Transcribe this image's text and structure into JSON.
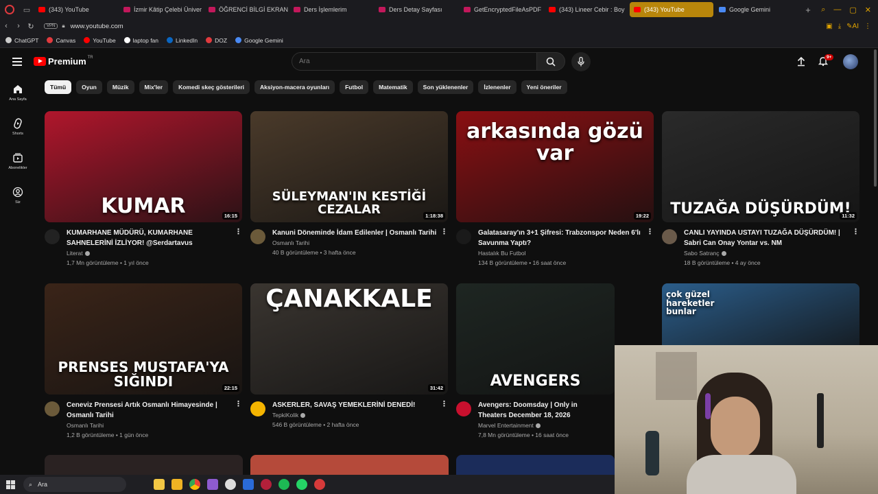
{
  "browser": {
    "tabs": [
      {
        "label": "(343) YouTube",
        "color": "#ff0000",
        "active": false
      },
      {
        "label": "İzmir Kâtip Çelebi Üniver",
        "color": "#c2185b",
        "active": false
      },
      {
        "label": "ÖĞRENCİ BİLGİ EKRANI*",
        "color": "#c2185b",
        "active": false
      },
      {
        "label": "Ders İşlemlerim",
        "color": "#c2185b",
        "active": false
      },
      {
        "label": "Ders Detay Sayfası",
        "color": "#c2185b",
        "active": false
      },
      {
        "label": "GetEncryptedFileAsPDF",
        "color": "#c2185b",
        "active": false
      },
      {
        "label": "(343) Lineer Cebir : Boy",
        "color": "#ff0000",
        "active": false
      },
      {
        "label": "(343) YouTube",
        "color": "#ff0000",
        "active": true
      },
      {
        "label": "Google Gemini",
        "color": "#4a8af4",
        "active": false
      }
    ],
    "vpn_label": "VPN",
    "url": "www.youtube.com",
    "ai_label": "AI",
    "bookmarks": [
      {
        "label": "ChatGPT",
        "color": "#cccccc"
      },
      {
        "label": "Canvas",
        "color": "#e03a3e"
      },
      {
        "label": "YouTube",
        "color": "#ff0000"
      },
      {
        "label": "laptop fan",
        "color": "#ffffff"
      },
      {
        "label": "LinkedIn",
        "color": "#0a66c2"
      },
      {
        "label": "DOZ",
        "color": "#e03a3e"
      },
      {
        "label": "Google Gemini",
        "color": "#4a8af4"
      }
    ]
  },
  "youtube": {
    "logo_text": "Premium",
    "logo_region": "TR",
    "search_placeholder": "Ara",
    "notification_count": "9+",
    "sidebar": [
      {
        "label": "Ana Sayfa",
        "icon": "home-icon"
      },
      {
        "label": "Shorts",
        "icon": "shorts-icon"
      },
      {
        "label": "Abonelikler",
        "icon": "subscriptions-icon"
      },
      {
        "label": "Siz",
        "icon": "you-icon"
      }
    ],
    "chips": [
      "Tümü",
      "Oyun",
      "Müzik",
      "Mix'ler",
      "Komedi skeç gösterileri",
      "Aksiyon-macera oyunları",
      "Futbol",
      "Matematik",
      "Son yüklenenler",
      "İzlenenler",
      "Yeni öneriler"
    ],
    "videos": [
      {
        "title": "KUMARHANE MÜDÜRÜ, KUMARHANE SAHNELERİNİ İZLİYOR! @Serdartavus",
        "channel": "Literat",
        "verified": true,
        "stats": "1,7 Mn görüntüleme • 1 yıl önce",
        "duration": "16:15",
        "thumb_text": "KUMAR",
        "bg": "#b0162c",
        "avatar": "#222222"
      },
      {
        "title": "Kanuni Döneminde İdam Edilenler | Osmanlı Tarihi",
        "channel": "Osmanlı Tarihi",
        "verified": false,
        "stats": "40 B görüntüleme • 3 hafta önce",
        "duration": "1:18:38",
        "thumb_text": "SÜLEYMAN'IN KESTİĞİ CEZALAR",
        "bg": "#4a3a2a",
        "avatar": "#6b5a3a"
      },
      {
        "title": "Galatasaray'ın 3+1 Şifresi: Trabzonspor Neden 6'lı Savunma Yaptı?",
        "channel": "Hastalık Bu Futbol",
        "verified": false,
        "stats": "134 B görüntüleme • 16 saat önce",
        "duration": "19:22",
        "thumb_text": "arkasında gözü var",
        "bg": "#8a0f12",
        "avatar": "#1a1a1a"
      },
      {
        "title": "CANLI YAYINDA USTAYI TUZAĞA DÜŞÜRDÜM! | Sabri Can Onay Yontar vs. NM",
        "channel": "Sabo Satranç",
        "verified": true,
        "stats": "18 B görüntüleme • 4 ay önce",
        "duration": "11:32",
        "thumb_text": "TUZAĞA DÜŞÜRDÜM!",
        "bg": "#2a2a2a",
        "avatar": "#6a5a4a"
      },
      {
        "title": "Ceneviz Prensesi Artık Osmanlı Himayesinde | Osmanlı Tarihi",
        "channel": "Osmanlı Tarihi",
        "verified": false,
        "stats": "1,2 B görüntüleme • 1 gün önce",
        "duration": "22:15",
        "thumb_text": "PRENSES MUSTAFA'YA SIĞINDI",
        "bg": "#3a2418",
        "avatar": "#6b5a3a"
      },
      {
        "title": "ASKERLER, SAVAŞ YEMEKLERİNİ DENEDİ!",
        "channel": "TepkiKolik",
        "verified": true,
        "stats": "546 B görüntüleme • 2 hafta önce",
        "duration": "31:42",
        "thumb_text": "ÇANAKKALE",
        "bg": "#3a3530",
        "avatar": "#f4b400"
      },
      {
        "title": "Avengers: Doomsday | Only in Theaters December 18, 2026",
        "channel": "Marvel Entertainment",
        "verified": true,
        "stats": "7,8 Mn görüntüleme • 16 saat önce",
        "duration": "",
        "thumb_text": "AVENGERS",
        "bg": "#1e2622",
        "avatar": "#c8102e"
      },
      {
        "title": "",
        "channel": "",
        "verified": false,
        "stats": "",
        "duration": "",
        "thumb_text": "çok güzel hareketler bunlar",
        "bg": "#2b5d8a",
        "avatar": "#333333"
      }
    ]
  },
  "taskbar": {
    "search_label": "Ara"
  }
}
